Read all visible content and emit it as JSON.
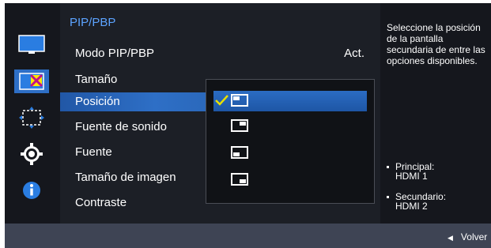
{
  "panel": {
    "title": "PIP/PBP",
    "items": [
      {
        "label": "Modo PIP/PBP",
        "value": "Act."
      },
      {
        "label": "Tamaño",
        "value": ""
      },
      {
        "label": "Posición",
        "value": ""
      },
      {
        "label": "Fuente de sonido",
        "value": ""
      },
      {
        "label": "Fuente",
        "value": ""
      },
      {
        "label": "Tamaño de imagen",
        "value": ""
      },
      {
        "label": "Contraste",
        "value": ""
      }
    ],
    "selected_index": 2
  },
  "sidebar": {
    "icons": [
      "monitor-icon",
      "pip-icon",
      "resize-icon",
      "gear-icon",
      "info-icon"
    ],
    "active": "pip-icon"
  },
  "dropdown": {
    "options": [
      {
        "icon": "position-top-left-icon",
        "checked": true
      },
      {
        "icon": "position-top-right-icon",
        "checked": false
      },
      {
        "icon": "position-bottom-left-icon",
        "checked": false
      },
      {
        "icon": "position-bottom-right-icon",
        "checked": false
      }
    ]
  },
  "help": {
    "text": "Seleccione la posición de la pantalla secundaria de entre las opciones disponibles.",
    "principal_label": "Principal:",
    "principal_value": "HDMI 1",
    "secundario_label": "Secundario:",
    "secundario_value": "HDMI 2"
  },
  "footer": {
    "back_label": "Volver"
  },
  "colors": {
    "accent": "#2e6fc6",
    "title": "#5ca3ff",
    "check": "#e8e000"
  }
}
